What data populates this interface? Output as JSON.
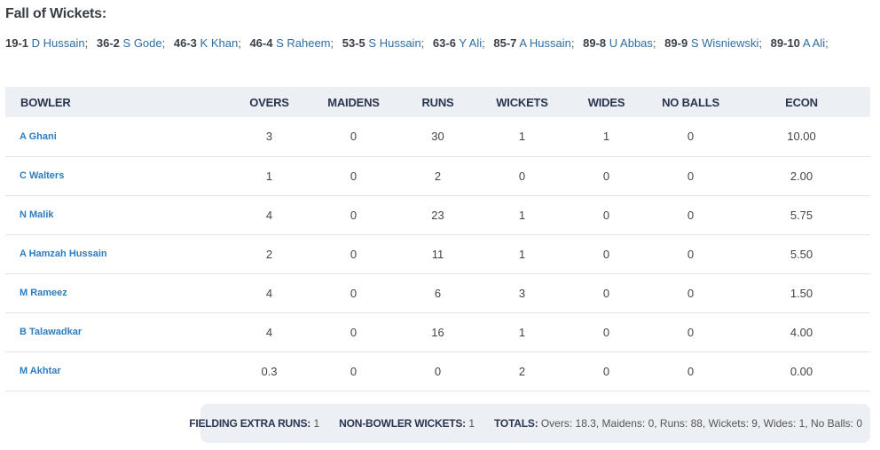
{
  "fall_of_wickets": {
    "title": "Fall of Wickets:",
    "items": [
      {
        "score": "19-1",
        "player": "D Hussain"
      },
      {
        "score": "36-2",
        "player": "S Gode"
      },
      {
        "score": "46-3",
        "player": "K Khan"
      },
      {
        "score": "46-4",
        "player": "S Raheem"
      },
      {
        "score": "53-5",
        "player": "S Hussain"
      },
      {
        "score": "63-6",
        "player": "Y Ali"
      },
      {
        "score": "85-7",
        "player": "A Hussain"
      },
      {
        "score": "89-8",
        "player": "U Abbas"
      },
      {
        "score": "89-9",
        "player": "S Wisniewski"
      },
      {
        "score": "89-10",
        "player": "A Ali"
      }
    ]
  },
  "bowling": {
    "headers": [
      "BOWLER",
      "OVERS",
      "MAIDENS",
      "RUNS",
      "WICKETS",
      "WIDES",
      "NO BALLS",
      "ECON"
    ],
    "rows": [
      [
        "A Ghani",
        "3",
        "0",
        "30",
        "1",
        "1",
        "0",
        "10.00"
      ],
      [
        "C Walters",
        "1",
        "0",
        "2",
        "0",
        "0",
        "0",
        "2.00"
      ],
      [
        "N Malik",
        "4",
        "0",
        "23",
        "1",
        "0",
        "0",
        "5.75"
      ],
      [
        "A Hamzah Hussain",
        "2",
        "0",
        "11",
        "1",
        "0",
        "0",
        "5.50"
      ],
      [
        "M Rameez",
        "4",
        "0",
        "6",
        "3",
        "0",
        "0",
        "1.50"
      ],
      [
        "B Talawadkar",
        "4",
        "0",
        "16",
        "1",
        "0",
        "0",
        "4.00"
      ],
      [
        "M Akhtar",
        "0.3",
        "0",
        "0",
        "2",
        "0",
        "0",
        "0.00"
      ]
    ]
  },
  "summary": {
    "fielding_label": "FIELDING EXTRA RUNS:",
    "fielding_value": "1",
    "non_bowler_label": "NON-BOWLER WICKETS:",
    "non_bowler_value": "1",
    "totals_label": "TOTALS:",
    "totals_value": "Overs: 18.3, Maidens: 0, Runs: 88, Wickets: 9, Wides: 1, No Balls: 0"
  },
  "colors": {
    "link": "#2d7cc1",
    "header_bg": "#eceff4",
    "heading_text": "#2a3550"
  }
}
